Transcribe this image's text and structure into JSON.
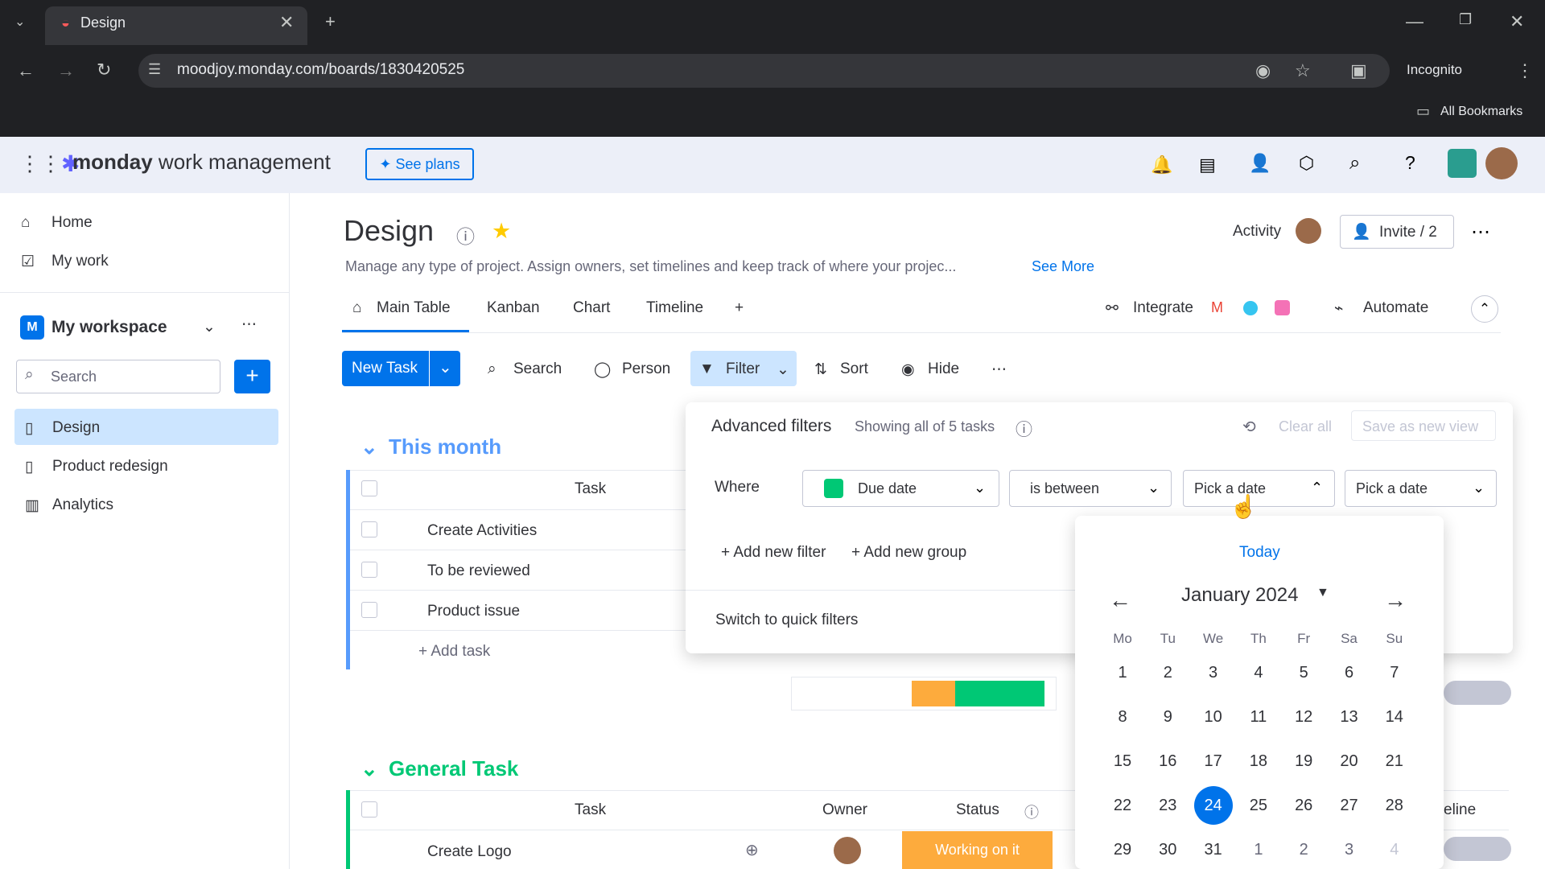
{
  "browser": {
    "tab_title": "Design",
    "url": "moodjoy.monday.com/boards/1830420525",
    "incognito": "Incognito",
    "bookmarks": "All Bookmarks"
  },
  "app": {
    "brand": "monday",
    "product": "work management",
    "see_plans": "See plans"
  },
  "sidebar": {
    "home": "Home",
    "mywork": "My work",
    "workspace": "My workspace",
    "search_placeholder": "Search",
    "boards": [
      {
        "label": "Design"
      },
      {
        "label": "Product redesign"
      },
      {
        "label": "Analytics"
      }
    ]
  },
  "board": {
    "title": "Design",
    "description": "Manage any type of project. Assign owners, set timelines and keep track of where your projec...",
    "see_more": "See More",
    "activity": "Activity",
    "invite": "Invite / 2",
    "tabs": [
      "Main Table",
      "Kanban",
      "Chart",
      "Timeline",
      "+"
    ],
    "integrate": "Integrate",
    "automate": "Automate"
  },
  "toolbar": {
    "new_task": "New Task",
    "search": "Search",
    "person": "Person",
    "filter": "Filter",
    "sort": "Sort",
    "hide": "Hide"
  },
  "groups": [
    {
      "name": "This month",
      "task_header": "Task",
      "tasks": [
        "Create Activities",
        "To be reviewed",
        "Product issue"
      ],
      "add_task": "+ Add task"
    },
    {
      "name": "General Task",
      "task_header": "Task",
      "owner": "Owner",
      "status": "Status",
      "partial_task": "Create Logo",
      "partial_status": "Working on it",
      "partial_timeline": "eline"
    }
  ],
  "filters": {
    "title": "Advanced filters",
    "showing": "Showing all of 5 tasks",
    "clear": "Clear all",
    "save": "Save as new view",
    "where": "Where",
    "column": "Due date",
    "condition": "is between",
    "pick1": "Pick a date",
    "pick2": "Pick a date",
    "add_filter": "+ Add new filter",
    "add_group": "+ Add new group",
    "switch": "Switch to quick filters"
  },
  "calendar": {
    "today": "Today",
    "month": "January 2024",
    "weekdays": [
      "Mo",
      "Tu",
      "We",
      "Th",
      "Fr",
      "Sa",
      "Su"
    ],
    "days": [
      "1",
      "2",
      "3",
      "4",
      "5",
      "6",
      "7",
      "8",
      "9",
      "10",
      "11",
      "12",
      "13",
      "14",
      "15",
      "16",
      "17",
      "18",
      "19",
      "20",
      "21",
      "22",
      "23",
      "24",
      "25",
      "26",
      "27",
      "28",
      "29",
      "30",
      "31",
      "1",
      "2",
      "3",
      "4"
    ],
    "selected": "24"
  },
  "colors": {
    "primary": "#0073ea",
    "this_month": "#579bfc",
    "general": "#00c875",
    "orange": "#fdab3d"
  }
}
